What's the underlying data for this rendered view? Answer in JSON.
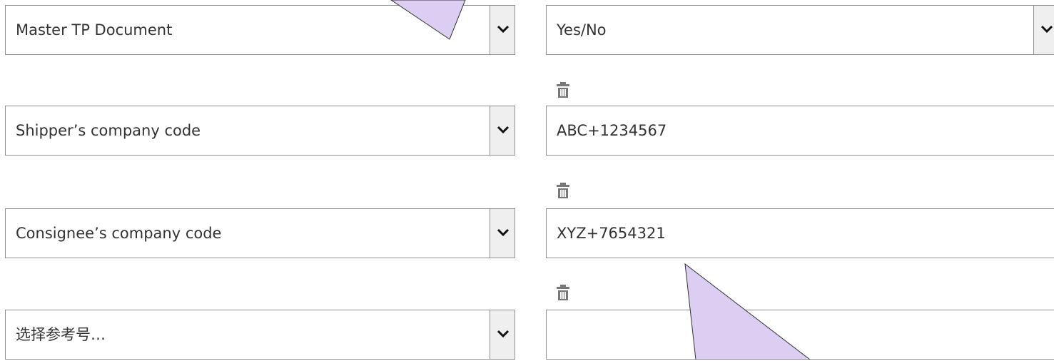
{
  "rows": [
    {
      "field": "Master TP Document",
      "value": "Yes/No"
    },
    {
      "field": "Shipper’s company code",
      "value": "ABC+1234567"
    },
    {
      "field": "Consignee’s company code",
      "value": "XYZ+7654321"
    },
    {
      "field": "选择参考号…",
      "value": ""
    }
  ],
  "icons": {
    "chevron": "chevron-down-icon",
    "delete": "trash-icon"
  },
  "colors": {
    "border": "#8f8f8f",
    "button_bg": "#efefef",
    "text": "#333333",
    "icon": "#777777",
    "callout_fill": "#dccdf2",
    "callout_stroke": "#333333"
  }
}
